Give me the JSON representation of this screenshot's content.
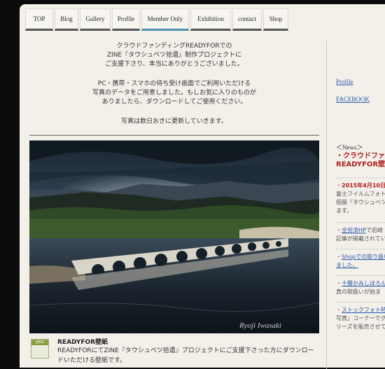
{
  "nav": [
    "TOP",
    "Blog",
    "Gallery",
    "Profile",
    "Member Only",
    "Exhibition",
    "contact",
    "Shop"
  ],
  "intro": {
    "p1": [
      "クラウドファンディングREADYFORでの",
      "ZINE『タウシュベツ拾遺』制作プロジェクトに",
      "ご支援下さり、本当にありがとうございました。"
    ],
    "p2": [
      "PC・携帯・スマホの待ち受け画面でご利用いただける",
      "写真のデータをご用意しました。もしお気に入りのものが",
      "ありましたら、ダウンロードしてご使用ください。"
    ],
    "p3": "写真は数日おきに更新していきます。"
  },
  "photo": {
    "watermark": "Ryoji Iwasaki"
  },
  "file": {
    "icon_label": "JPEG",
    "title": "READYFOR壁紙",
    "desc": "READYFORにてZINE『タウシュベツ拾遺』プロジェクトにご支援下さった方にダウンロードいただける壁紙です。"
  },
  "sidebar": {
    "links": [
      "Profile",
      "FACEBOOK"
    ],
    "news_title": "＜News＞",
    "item1_bullet": "・",
    "item1_line1": "クラウドファン",
    "item1_line2": "READYFOR壁",
    "item2_bullet": "・",
    "item2_date": "2015年4月10日～",
    "item2_l1": "富士フイルムフォト",
    "item2_l2": "個展『タウシュベツ拾",
    "item2_l3": "ます。",
    "item3_bullet": "・",
    "item3_link": "全労済HP",
    "item3_l1_rest": "で岩崎",
    "item3_l2": "記事が掲載されてい",
    "item4_bullet": "・",
    "item4_link1": "Shopでの取り扱い",
    "item4_link2": "ました。",
    "item5_bullet": "・",
    "item5_link": "十勝かみしほろん",
    "item5_l2": "真の取扱いが始ま",
    "item6_bullet": "・",
    "item6_link": "ストックフォト時空",
    "item6_l1": "写真」コーナーでグ",
    "item6_l2": "リーズを販売させて"
  },
  "colors": {
    "active_tab": "#4a8fb0",
    "link": "#2a5aa8",
    "accent": "#b02020"
  }
}
